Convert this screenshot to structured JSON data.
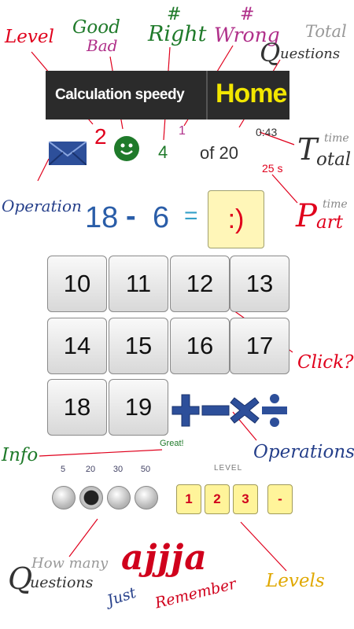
{
  "header": {
    "title": "Calculation speedy",
    "home": "Home"
  },
  "stats": {
    "level": "2",
    "right": "4",
    "wrong": "1",
    "of_label": "of 20",
    "total_time": "0:43",
    "part_time": "25 s"
  },
  "problem": {
    "left": "18",
    "operator": "-",
    "right": "6",
    "equals": "=",
    "answer": ":)"
  },
  "keypad": [
    "10",
    "11",
    "12",
    "13",
    "14",
    "15",
    "16",
    "17",
    "18",
    "19"
  ],
  "operations": [
    {
      "icon": "plus-icon"
    },
    {
      "icon": "minus-icon"
    },
    {
      "icon": "multiply-icon"
    },
    {
      "icon": "divide-icon"
    }
  ],
  "info": {
    "message": "Great!"
  },
  "question_counts": {
    "options": [
      "5",
      "20",
      "30",
      "50"
    ],
    "selected": "20"
  },
  "levels": {
    "label": "LEVEL",
    "options": [
      "1",
      "2",
      "3",
      "-"
    ]
  },
  "annotations": {
    "level": "Level",
    "good": "Good",
    "bad": "Bad",
    "right_hash": "#",
    "right": "Right",
    "wrong_hash": "#",
    "wrong": "Wrong",
    "total_q_big": "Q",
    "total_q_small": "Total",
    "total_q_rest": "uestions",
    "operation": "Operation",
    "total_time_big": "T",
    "total_time_small": "time",
    "total_time_rest": "otal",
    "part_time_big": "P",
    "part_time_small": "time",
    "part_time_rest": "art",
    "click": "Click?",
    "info": "Info",
    "operations": "Operations",
    "how_many_big": "Q",
    "how_many_small": "How many",
    "how_many_rest": "uestions",
    "levels": "Levels",
    "logo": "ajjja",
    "just": "Just",
    "remember": "Remember"
  },
  "colors": {
    "header_bg": "#2b2b2b",
    "home_yellow": "#f2e600",
    "level_red": "#e0001c",
    "right_green": "#1f7a2a",
    "wrong_purple": "#b0308a",
    "problem_blue": "#2a5da8",
    "operation_blue": "#253f8a"
  }
}
